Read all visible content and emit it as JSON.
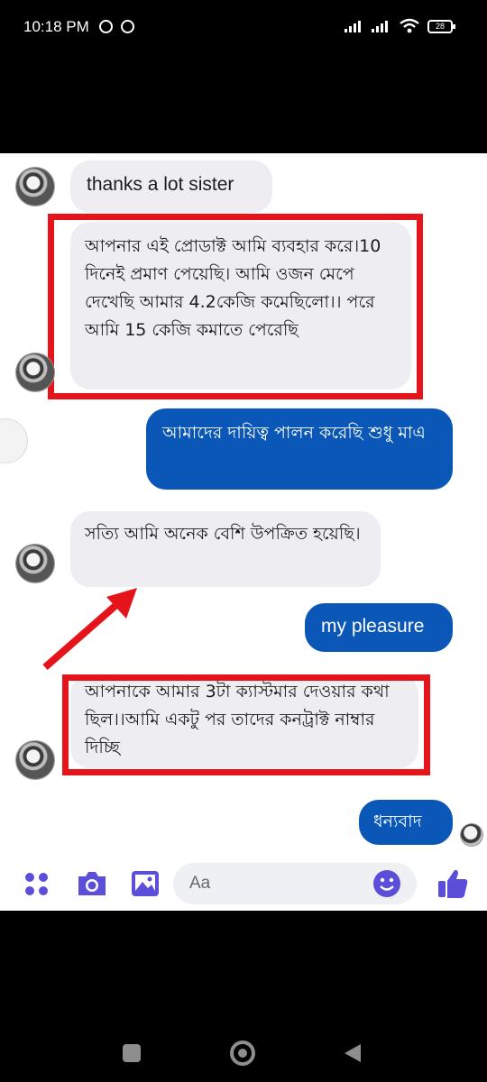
{
  "status_bar": {
    "time": "10:18 PM",
    "battery": "28"
  },
  "messages": {
    "m1": "thanks a lot sister",
    "m2": "আপনার এই প্রোডাক্ট আমি ব্যবহার করে।10 দিনেই প্রমাণ পেয়েছি। আমি ওজন মেপে দেখেছি আমার 4.2কেজি কমেছিলো।। পরে আমি 15 কেজি কমাতে পেরেছি",
    "m3": "আমাদের দায়িত্ব পালন করেছি শুধু মাএ",
    "m4": "সত্যি আমি অনেক বেশি উপক্রিত হয়েছি।",
    "m5": "my pleasure",
    "m6": "আপনাকে আমার 3টা ক্যাস্টমার দেওয়ার কথা ছিল।।আমি একটু পর তাদের কনট্রাক্ট  নাম্বার দিচ্ছি",
    "m7": "ধন্যবাদ"
  },
  "composer": {
    "placeholder": "Aa"
  },
  "colors": {
    "outgoing_bubble": "#0a57b8",
    "incoming_bubble": "#eeeef2",
    "highlight": "#e5141b",
    "messenger_accent": "#5b4fd9"
  },
  "icons": [
    "whatsapp-icon",
    "clock-icon",
    "signal-icon",
    "wifi-icon",
    "battery-icon",
    "apps-icon",
    "camera-icon",
    "image-icon",
    "emoji-icon",
    "thumbs-up-icon",
    "recents-icon",
    "home-icon",
    "back-icon"
  ]
}
